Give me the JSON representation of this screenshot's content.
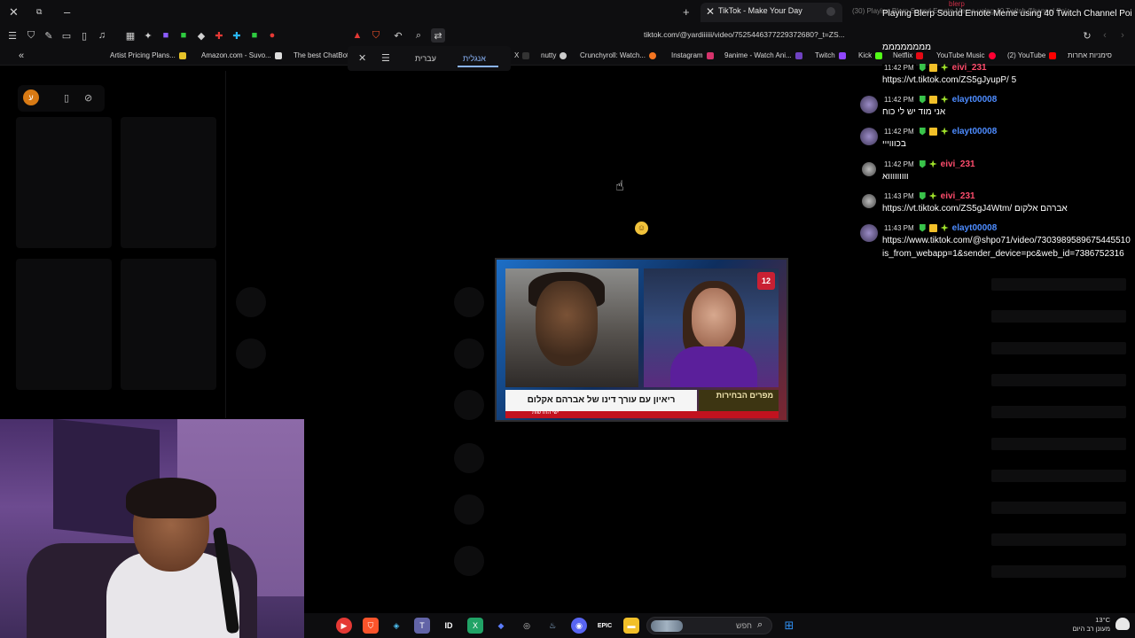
{
  "browser": {
    "active_tab_title": "TikTok - Make Your Day",
    "ghost_tab_text": "(30) Playing Blerp Sound Emote Meme using 40 Twitch Channel Poi",
    "url": "tiktok.com/@yardiiiiii/video/7525446377229372680?_t=ZS...",
    "bookmarks": [
      "Artist Pricing Plans...",
      "Amazon.com - Suvo...",
      "The best ChatBot",
      "X",
      "nutty",
      "Crunchyroll: Watch...",
      "Instagram",
      "9anime - Watch Ani...",
      "Twitch",
      "Kick",
      "Netflix",
      "YouTube Music",
      "(2) YouTube",
      "סימניות אחרות"
    ],
    "translate": {
      "lang_source": "עברית",
      "lang_target": "אנגלית"
    }
  },
  "left_panel": {
    "avatar_letter": "ע"
  },
  "news_thumb": {
    "headline": "ריאיון עם עורך דינו של אברהם אקלום",
    "badge": "מפרים הבחירות",
    "channel": "12",
    "ticker": "ישי החדשות"
  },
  "chat": {
    "overlay_title": "Playing Blerp Sound Emote Meme using 40 Twitch Channel Poi",
    "top_user": "blerp",
    "overlay_sub": "ממממממממ",
    "messages": [
      {
        "time": "11:42 PM",
        "user": "eivi_231",
        "user_color": "#ff4d6d",
        "text": "https://vt.tiktok.com/ZS5gJyupP/ 5",
        "text2": ""
      },
      {
        "time": "11:42 PM",
        "user": "elayt00008",
        "user_color": "#4d8cff",
        "text": "אני מוד יש לי כוח",
        "text2": ""
      },
      {
        "time": "11:42 PM",
        "user": "elayt00008",
        "user_color": "#4d8cff",
        "text": "בכוווייי",
        "text2": ""
      },
      {
        "time": "11:42 PM",
        "user": "eivi_231",
        "user_color": "#ff4d6d",
        "text": "וווווווווא",
        "text2": ""
      },
      {
        "time": "11:43 PM",
        "user": "eivi_231",
        "user_color": "#ff4d6d",
        "text": "https://vt.tiktok.com/ZS5gJ4Wtm/ אברהם אלקום",
        "text2": ""
      },
      {
        "time": "11:43 PM",
        "user": "elayt00008",
        "user_color": "#4d8cff",
        "text": "https://www.tiktok.com/@shpo71/video/7303989589675445510",
        "text2": "is_from_webapp=1&sender_device=pc&web_id=7386752316"
      }
    ]
  },
  "taskbar": {
    "search_placeholder": "חפש",
    "weather_temp": "13°C",
    "weather_desc": "מעונן רב היום"
  }
}
